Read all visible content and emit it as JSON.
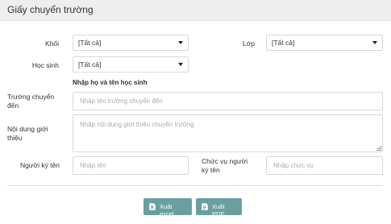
{
  "header": {
    "title": "Giấy chuyển trường"
  },
  "fields": {
    "khoi": {
      "label": "Khối",
      "value": "[Tất cả]"
    },
    "lop": {
      "label": "Lớp",
      "value": "[Tất cả]"
    },
    "hoc_sinh": {
      "label": "Học sinh",
      "value": "[Tất cả]",
      "hint": "Nhập họ và tên học sinh"
    },
    "truong_chuyen_den": {
      "label_line1": "Trường chuyển",
      "label_line2": "đến",
      "placeholder": "Nhập tên trường chuyển đến"
    },
    "noi_dung": {
      "label_line1": "Nội dung giới",
      "label_line2": "thiệu",
      "placeholder": "Nhập nội dung giới thiệu chuyển trường"
    },
    "nguoi_ky_ten": {
      "label": "Người ký tên",
      "placeholder": "Nhập tên"
    },
    "chuc_vu": {
      "label_line1": "Chức vụ người",
      "label_line2": "ký tên",
      "placeholder": "Nhập chức vụ"
    }
  },
  "buttons": {
    "excel": {
      "label": "Xuất excel",
      "icon": "excel-file-icon"
    },
    "pdf": {
      "label": "Xuất PDF",
      "icon": "pdf-file-icon"
    }
  },
  "colors": {
    "button_bg": "#6a9fa0",
    "header_bg": "#eeeeee"
  }
}
